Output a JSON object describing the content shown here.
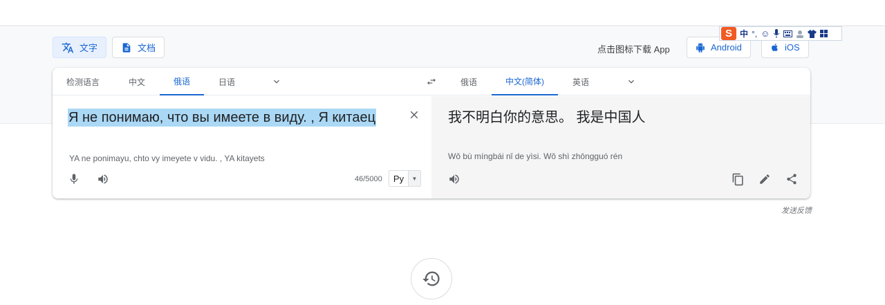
{
  "modes": {
    "text_label": "文字",
    "docs_label": "文档"
  },
  "app_promo": {
    "text": "点击图标下载 App",
    "android_label": "Android",
    "ios_label": "iOS"
  },
  "ime_bar": {
    "logo": "S",
    "mode": "中",
    "punct": "°,"
  },
  "source_langs": {
    "tabs": [
      "检测语言",
      "中文",
      "俄语",
      "日语"
    ],
    "active": "俄语"
  },
  "target_langs": {
    "tabs": [
      "俄语",
      "中文(简体)",
      "英语"
    ],
    "active": "中文(简体)"
  },
  "source": {
    "text": "Я не понимаю, что вы имеете в виду. , Я китаец",
    "transliteration": "YA ne ponimayu, chto vy imeyete v vidu. , YA kitayets",
    "char_count": "46/5000",
    "keyboard_label": "Ру"
  },
  "target": {
    "text": "我不明白你的意思。 我是中国人",
    "transliteration": "Wǒ bù míngbái nǐ de yìsi. Wǒ shì zhōngguó rén"
  },
  "feedback_label": "发送反馈",
  "colors": {
    "accent": "#1967d2",
    "highlight": "#aad8f5",
    "target_bg": "#f5f5f5"
  }
}
